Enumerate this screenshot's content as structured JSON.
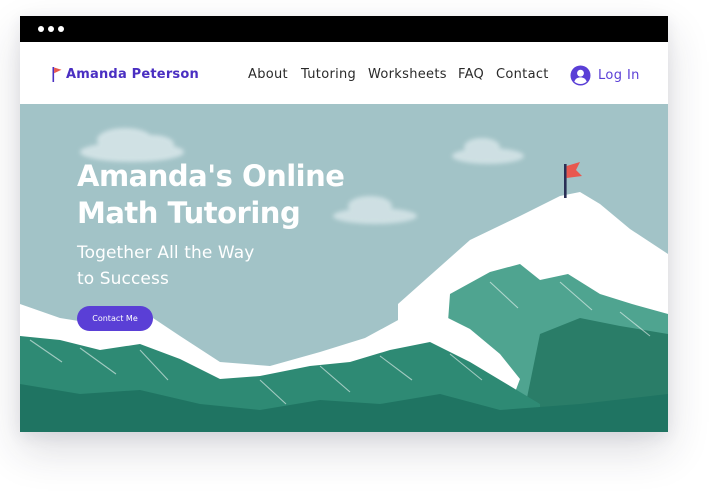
{
  "window": {
    "controls": [
      "dot-icon",
      "dot-icon",
      "dot-icon"
    ]
  },
  "header": {
    "brand": "Amanda Peterson",
    "brand_icon": "flag-icon",
    "nav": [
      {
        "label": "About"
      },
      {
        "label": "Tutoring"
      },
      {
        "label": "Worksheets"
      },
      {
        "label": "FAQ"
      },
      {
        "label": "Contact"
      }
    ],
    "login_label": "Log In",
    "login_icon": "user-avatar-icon"
  },
  "hero": {
    "title_line1": "Amanda's Online",
    "title_line2": "Math Tutoring",
    "subtitle_line1": "Together All the Way",
    "subtitle_line2": "to Success",
    "cta_label": "Contact Me"
  },
  "colors": {
    "brand": "#4a2fc2",
    "accent": "#5a3fd6",
    "sky": "#a2c3c7",
    "mountain": "#2e8a74",
    "flag": "#e8584f"
  }
}
